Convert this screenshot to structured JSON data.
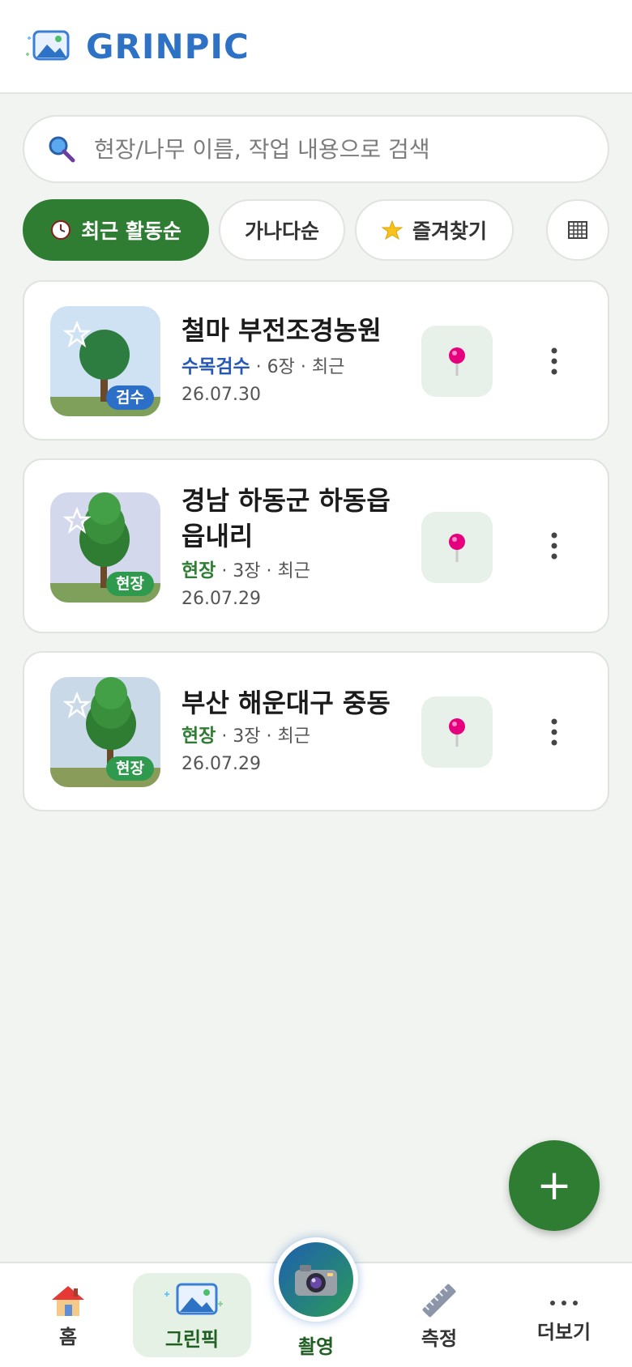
{
  "header": {
    "title": "GRINPIC"
  },
  "search": {
    "placeholder": "현장/나무 이름, 작업 내용으로 검색"
  },
  "filters": [
    {
      "label": "최근 활동순",
      "active": true
    },
    {
      "label": "가나다순",
      "active": false
    },
    {
      "label": "즐겨찾기",
      "active": false
    }
  ],
  "projects": [
    {
      "name": "철마 부전조경농원",
      "tag": "검수",
      "kind": "수목검수",
      "detail": " · 6장 · 최근",
      "date": "26.07.30"
    },
    {
      "name": "경남 하동군 하동읍 읍내리",
      "tag": "현장",
      "kind": "현장",
      "detail": " · 3장 · 최근",
      "date": "26.07.29"
    },
    {
      "name": "부산 해운대구 중동",
      "tag": "현장",
      "kind": "현장",
      "detail": " · 3장 · 최근",
      "date": "26.07.29"
    }
  ],
  "fab": {
    "label": "+"
  },
  "nav": [
    {
      "label": "홈",
      "icon": "home-icon"
    },
    {
      "label": "그린픽",
      "icon": "gallery-icon",
      "active": true
    },
    {
      "label": "촬영",
      "icon": "camera-icon"
    },
    {
      "label": "측정",
      "icon": "ruler-icon"
    },
    {
      "label": "더보기",
      "icon": "more-dots-icon"
    }
  ],
  "colors": {
    "brand_blue": "#2d72c4",
    "primary_green": "#2e7d32",
    "pin_pink": "#e6007e"
  }
}
